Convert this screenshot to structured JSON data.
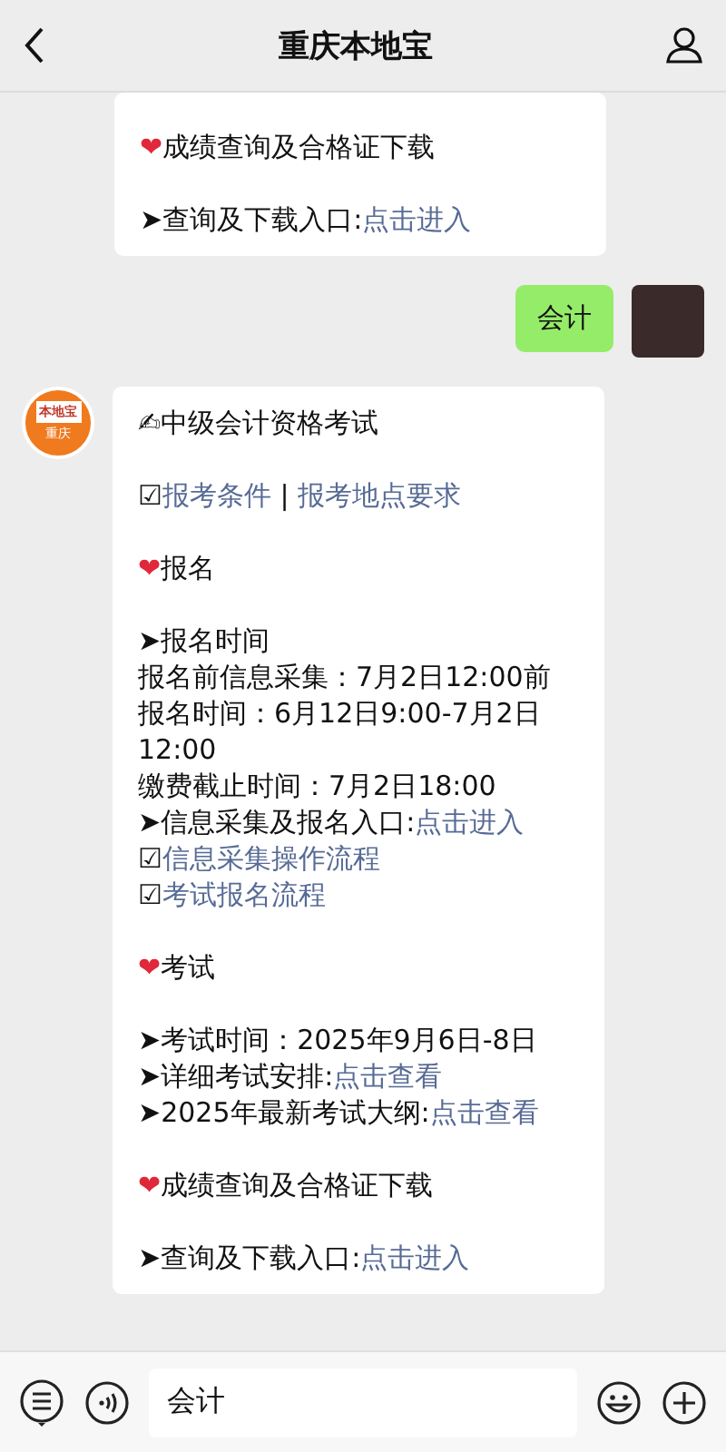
{
  "header": {
    "title": "重庆本地宝"
  },
  "messages": [
    {
      "kind": "incoming_cont",
      "lines": [
        {
          "kind": "blank"
        },
        {
          "kind": "text",
          "parts": [
            {
              "text": "❤",
              "kind": "heart"
            },
            {
              "text": "成绩查询及合格证下载",
              "kind": "plain"
            }
          ]
        },
        {
          "kind": "blank"
        },
        {
          "kind": "text",
          "parts": [
            {
              "text": "➤",
              "kind": "mark"
            },
            {
              "text": "查询及下载入口:",
              "kind": "plain"
            },
            {
              "text": "点击进入",
              "kind": "link"
            }
          ]
        }
      ]
    },
    {
      "kind": "outgoing",
      "text": "会计"
    },
    {
      "kind": "incoming",
      "lines": [
        {
          "kind": "text",
          "parts": [
            {
              "text": "✍",
              "kind": "mark"
            },
            {
              "text": "中级会计资格考试",
              "kind": "plain"
            }
          ]
        },
        {
          "kind": "blank"
        },
        {
          "kind": "text",
          "parts": [
            {
              "text": "☑",
              "kind": "mark"
            },
            {
              "text": "报考条件",
              "kind": "link"
            },
            {
              "text": " | ",
              "kind": "plain"
            },
            {
              "text": "报考地点要求",
              "kind": "link"
            }
          ]
        },
        {
          "kind": "blank"
        },
        {
          "kind": "text",
          "parts": [
            {
              "text": "❤",
              "kind": "heart"
            },
            {
              "text": "报名",
              "kind": "plain"
            }
          ]
        },
        {
          "kind": "blank"
        },
        {
          "kind": "text",
          "parts": [
            {
              "text": "➤",
              "kind": "mark"
            },
            {
              "text": "报名时间",
              "kind": "plain"
            }
          ]
        },
        {
          "kind": "text",
          "parts": [
            {
              "text": "报名前信息采集：7月2日12:00前",
              "kind": "plain"
            }
          ]
        },
        {
          "kind": "text",
          "parts": [
            {
              "text": "报名时间：6月12日9:00-7月2日 12:00",
              "kind": "plain"
            }
          ]
        },
        {
          "kind": "text",
          "parts": [
            {
              "text": "缴费截止时间：7月2日18:00",
              "kind": "plain"
            }
          ]
        },
        {
          "kind": "text",
          "parts": [
            {
              "text": "➤",
              "kind": "mark"
            },
            {
              "text": "信息采集及报名入口:",
              "kind": "plain"
            },
            {
              "text": "点击进入",
              "kind": "link"
            }
          ]
        },
        {
          "kind": "text",
          "parts": [
            {
              "text": "☑",
              "kind": "mark"
            },
            {
              "text": "信息采集操作流程",
              "kind": "link"
            }
          ]
        },
        {
          "kind": "text",
          "parts": [
            {
              "text": "☑",
              "kind": "mark"
            },
            {
              "text": "考试报名流程",
              "kind": "link"
            }
          ]
        },
        {
          "kind": "blank"
        },
        {
          "kind": "text",
          "parts": [
            {
              "text": "❤",
              "kind": "heart"
            },
            {
              "text": "考试",
              "kind": "plain"
            }
          ]
        },
        {
          "kind": "blank"
        },
        {
          "kind": "text",
          "parts": [
            {
              "text": "➤",
              "kind": "mark"
            },
            {
              "text": "考试时间：2025年9月6日-8日",
              "kind": "plain"
            }
          ]
        },
        {
          "kind": "text",
          "parts": [
            {
              "text": "➤",
              "kind": "mark"
            },
            {
              "text": "详细考试安排:",
              "kind": "plain"
            },
            {
              "text": "点击查看",
              "kind": "link"
            }
          ]
        },
        {
          "kind": "text",
          "parts": [
            {
              "text": "➤",
              "kind": "mark"
            },
            {
              "text": "2025年最新考试大纲:",
              "kind": "plain"
            },
            {
              "text": "点击查看",
              "kind": "link"
            }
          ]
        },
        {
          "kind": "blank"
        },
        {
          "kind": "text",
          "parts": [
            {
              "text": "❤",
              "kind": "heart"
            },
            {
              "text": "成绩查询及合格证下载",
              "kind": "plain"
            }
          ]
        },
        {
          "kind": "blank"
        },
        {
          "kind": "text",
          "parts": [
            {
              "text": "➤",
              "kind": "mark"
            },
            {
              "text": "查询及下载入口:",
              "kind": "plain"
            },
            {
              "text": "点击进入",
              "kind": "link"
            }
          ]
        }
      ]
    }
  ],
  "logo": {
    "top": "本地宝",
    "bottom": "重庆"
  },
  "input": {
    "value": "会计"
  }
}
